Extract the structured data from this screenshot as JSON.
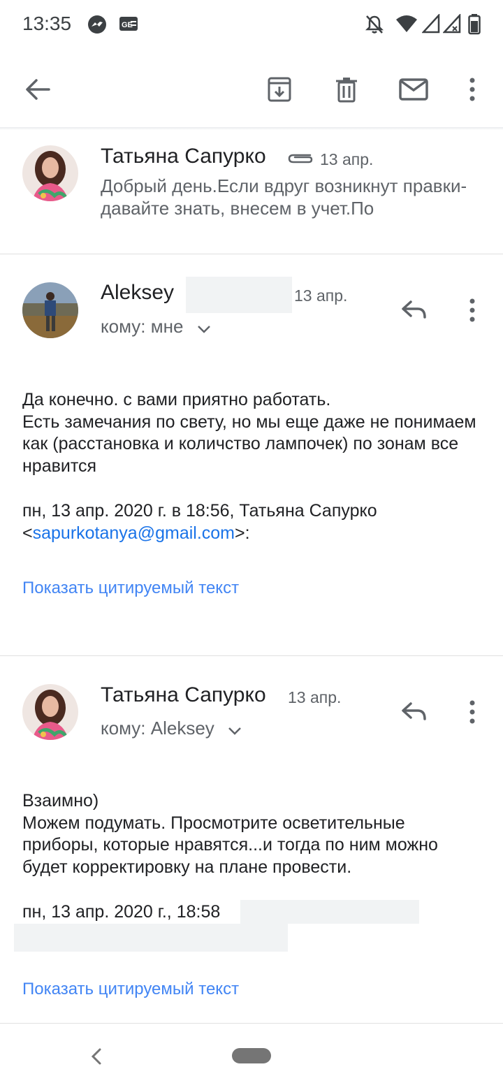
{
  "status_bar": {
    "time": "13:35",
    "icons": [
      "messenger-icon",
      "news-icon",
      "mute-icon",
      "wifi-icon",
      "signal-icon",
      "signal-x-icon",
      "battery-icon"
    ]
  },
  "toolbar": {
    "icons": [
      "back-arrow-icon",
      "archive-icon",
      "delete-icon",
      "mark-unread-icon",
      "more-vert-icon"
    ]
  },
  "messages": [
    {
      "sender": "Татьяна Сапурко",
      "date": "13 апр.",
      "snippet": "Добрый день.Если вдруг возникнут правки-давайте знать, внесем в учет.По",
      "has_attachment": true
    },
    {
      "sender": "Aleksey",
      "date": "13 апр.",
      "to_label": "кому: мне",
      "body": "Да конечно. с вами приятно работать.\nЕсть замечания по свету, но мы еще даже не понимаем как (расстановка и количство лампочек) по зонам все нравится",
      "quote_header_prefix": "пн, 13 апр. 2020 г. в 18:56, Татьяна Сапурко",
      "quote_header_open": "<",
      "quote_email": "sapurkotanya@gmail.com",
      "quote_header_close": ">:",
      "show_quoted": "Показать цитируемый текст"
    },
    {
      "sender": "Татьяна Сапурко",
      "date": "13 апр.",
      "to_label": "кому: Aleksey",
      "body": "Взаимно)\nМожем подумать. Просмотрите осветительные приборы, которые нравятся...и тогда по ним можно будет корректировку на плане провести.",
      "quote_header_prefix": "пн, 13 апр. 2020 г., 18:58",
      "show_quoted": "Показать цитируемый текст"
    }
  ],
  "colors": {
    "accent_link": "#1a73e8",
    "secondary_text": "#5f6368",
    "primary_text": "#202124",
    "divider": "#e0e0e0"
  }
}
